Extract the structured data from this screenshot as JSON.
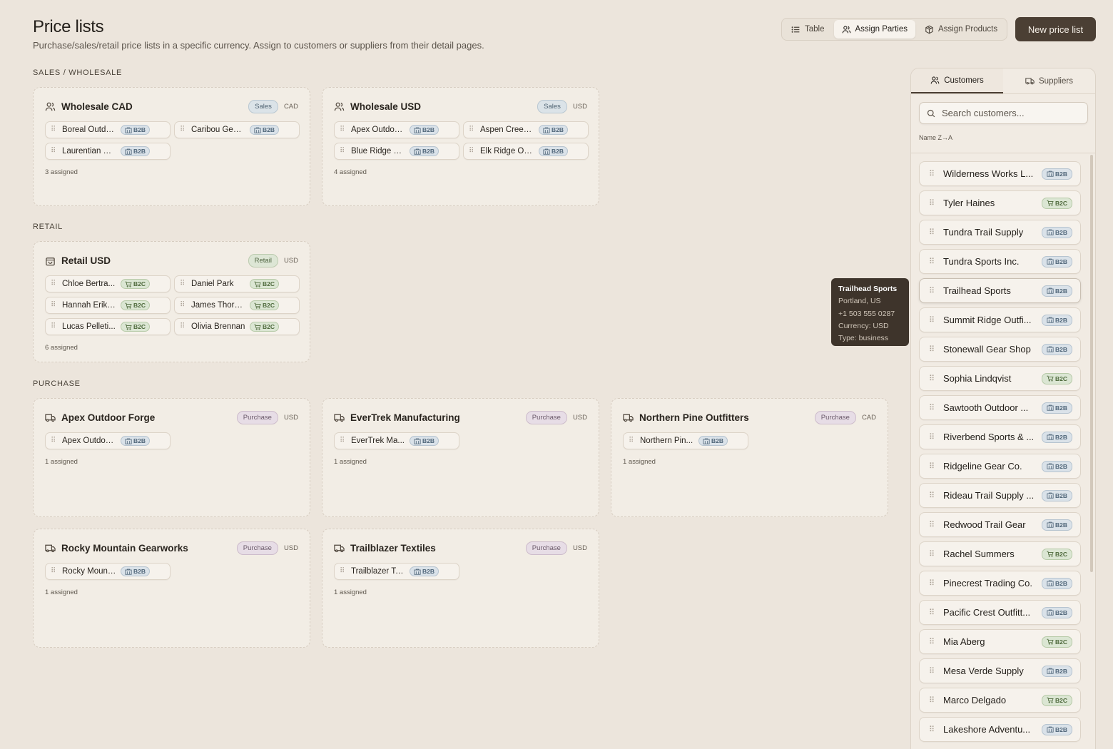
{
  "header": {
    "title": "Price lists",
    "subtitle": "Purchase/sales/retail price lists in a specific currency. Assign to customers or suppliers from their detail pages.",
    "view_tabs": [
      {
        "label": "Table",
        "icon": "list-icon",
        "active": false
      },
      {
        "label": "Assign Parties",
        "icon": "users-icon",
        "active": true
      },
      {
        "label": "Assign Products",
        "icon": "box-icon",
        "active": false
      }
    ],
    "new_button": "New price list"
  },
  "sections": {
    "sales": "SALES / WHOLESALE",
    "retail": "RETAIL",
    "purchase": "PURCHASE"
  },
  "cards": [
    {
      "title": "Wholesale CAD",
      "type": "Sales",
      "currency": "CAD",
      "icon": "users-icon",
      "chips": [
        {
          "name": "Boreal Outdo...",
          "tag": "B2B"
        },
        {
          "name": "Caribou Gear...",
          "tag": "B2B"
        },
        {
          "name": "Laurentian O...",
          "tag": "B2B"
        }
      ],
      "assigned": "3 assigned"
    },
    {
      "title": "Wholesale USD",
      "type": "Sales",
      "currency": "USD",
      "icon": "users-icon",
      "chips": [
        {
          "name": "Apex Outdoo...",
          "tag": "B2B"
        },
        {
          "name": "Aspen Creek ...",
          "tag": "B2B"
        },
        {
          "name": "Blue Ridge M...",
          "tag": "B2B"
        },
        {
          "name": "Elk Ridge Ou...",
          "tag": "B2B"
        }
      ],
      "assigned": "4 assigned"
    },
    {
      "title": "Retail USD",
      "type": "Retail",
      "currency": "USD",
      "icon": "bag-icon",
      "chips": [
        {
          "name": "Chloe Bertra...",
          "tag": "B2C"
        },
        {
          "name": "Daniel Park",
          "tag": "B2C"
        },
        {
          "name": "Hannah Eriks...",
          "tag": "B2C"
        },
        {
          "name": "James Thorn...",
          "tag": "B2C"
        },
        {
          "name": "Lucas Pelleti...",
          "tag": "B2C"
        },
        {
          "name": "Olivia Brennan",
          "tag": "B2C"
        }
      ],
      "assigned": "6 assigned"
    },
    {
      "title": "Apex Outdoor Forge",
      "type": "Purchase",
      "currency": "USD",
      "icon": "truck-icon",
      "chips": [
        {
          "name": "Apex Outdoo...",
          "tag": "B2B"
        }
      ],
      "assigned": "1 assigned"
    },
    {
      "title": "EverTrek Manufacturing",
      "type": "Purchase",
      "currency": "USD",
      "icon": "truck-icon",
      "chips": [
        {
          "name": "EverTrek Ma...",
          "tag": "B2B"
        }
      ],
      "assigned": "1 assigned"
    },
    {
      "title": "Northern Pine Outfitters",
      "type": "Purchase",
      "currency": "CAD",
      "icon": "truck-icon",
      "chips": [
        {
          "name": "Northern Pin...",
          "tag": "B2B"
        }
      ],
      "assigned": "1 assigned"
    },
    {
      "title": "Rocky Mountain Gearworks",
      "type": "Purchase",
      "currency": "USD",
      "icon": "truck-icon",
      "chips": [
        {
          "name": "Rocky Mount...",
          "tag": "B2B"
        }
      ],
      "assigned": "1 assigned"
    },
    {
      "title": "Trailblazer Textiles",
      "type": "Purchase",
      "currency": "USD",
      "icon": "truck-icon",
      "chips": [
        {
          "name": "Trailblazer Te...",
          "tag": "B2B"
        }
      ],
      "assigned": "1 assigned"
    }
  ],
  "panel": {
    "tabs": [
      {
        "label": "Customers",
        "icon": "users-icon",
        "active": true
      },
      {
        "label": "Suppliers",
        "icon": "truck-icon",
        "active": false
      }
    ],
    "search_placeholder": "Search customers...",
    "sort_label": "Name Z→A",
    "items": [
      {
        "name": "Wilderness Works L...",
        "tag": "B2B"
      },
      {
        "name": "Tyler Haines",
        "tag": "B2C"
      },
      {
        "name": "Tundra Trail Supply",
        "tag": "B2B"
      },
      {
        "name": "Tundra Sports Inc.",
        "tag": "B2B"
      },
      {
        "name": "Trailhead Sports",
        "tag": "B2B",
        "hover": true
      },
      {
        "name": "Summit Ridge Outfi...",
        "tag": "B2B"
      },
      {
        "name": "Stonewall Gear Shop",
        "tag": "B2B"
      },
      {
        "name": "Sophia Lindqvist",
        "tag": "B2C"
      },
      {
        "name": "Sawtooth Outdoor ...",
        "tag": "B2B"
      },
      {
        "name": "Riverbend Sports & ...",
        "tag": "B2B"
      },
      {
        "name": "Ridgeline Gear Co.",
        "tag": "B2B"
      },
      {
        "name": "Rideau Trail Supply ...",
        "tag": "B2B"
      },
      {
        "name": "Redwood Trail Gear",
        "tag": "B2B"
      },
      {
        "name": "Rachel Summers",
        "tag": "B2C"
      },
      {
        "name": "Pinecrest Trading Co.",
        "tag": "B2B"
      },
      {
        "name": "Pacific Crest Outfitt...",
        "tag": "B2B"
      },
      {
        "name": "Mia Aberg",
        "tag": "B2C"
      },
      {
        "name": "Mesa Verde Supply",
        "tag": "B2B"
      },
      {
        "name": "Marco Delgado",
        "tag": "B2C"
      },
      {
        "name": "Lakeshore Adventu...",
        "tag": "B2B"
      }
    ]
  },
  "tooltip": {
    "title": "Trailhead Sports",
    "lines": [
      "Portland, US",
      "+1 503 555 0287",
      "Currency: USD",
      "Type: business"
    ]
  }
}
